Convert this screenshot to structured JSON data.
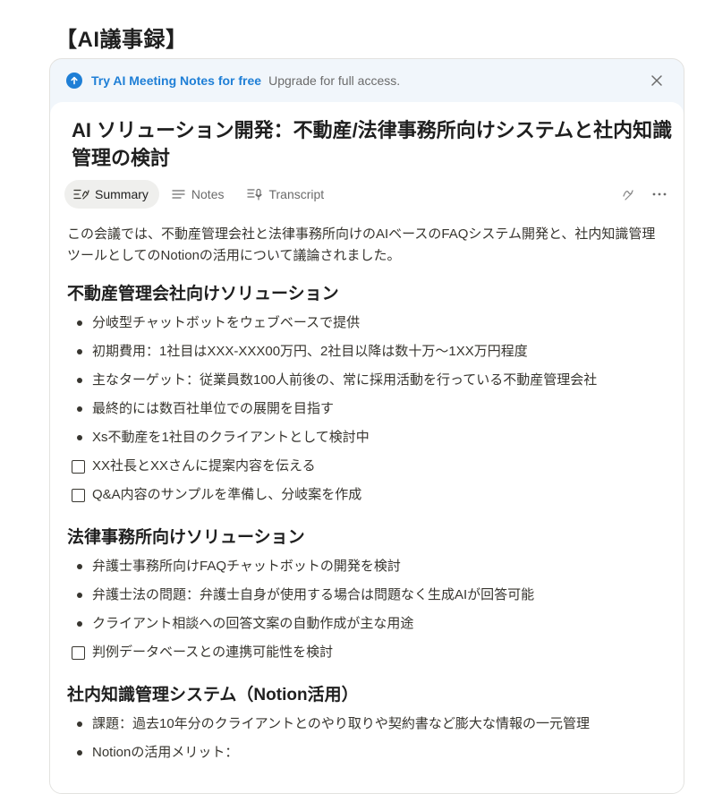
{
  "page_title": "【AI議事録】",
  "banner": {
    "cta": "Try AI Meeting Notes for free",
    "sub": "Upgrade for full access.",
    "icon": "arrow-up-circle-icon",
    "close_icon": "close-icon"
  },
  "meeting": {
    "title": "AI ソリューション開発：不動産/法律事務所向けシステムと社内知識管理の検討"
  },
  "tabs": [
    {
      "label": "Summary",
      "icon": "summary-icon",
      "active": true
    },
    {
      "label": "Notes",
      "icon": "notes-icon",
      "active": false
    },
    {
      "label": "Transcript",
      "icon": "transcript-icon",
      "active": false
    }
  ],
  "intro": "この会議では、不動産管理会社と法律事務所向けのAIベースのFAQシステム開発と、社内知識管理ツールとしてのNotionの活用について議論されました。",
  "sections": [
    {
      "heading": "不動産管理会社向けソリューション",
      "bullets": [
        "分岐型チャットボットをウェブベースで提供",
        "初期費用：1社目はXXX-XXX00万円、2社目以降は数十万〜1XX万円程度",
        "主なターゲット：従業員数100人前後の、常に採用活動を行っている不動産管理会社",
        "最終的には数百社単位での展開を目指す",
        "Xs不動産を1社目のクライアントとして検討中"
      ],
      "todos": [
        "XX社長とXXさんに提案内容を伝える",
        "Q&A内容のサンプルを準備し、分岐案を作成"
      ]
    },
    {
      "heading": "法律事務所向けソリューション",
      "bullets": [
        "弁護士事務所向けFAQチャットボットの開発を検討",
        "弁護士法の問題：弁護士自身が使用する場合は問題なく生成AIが回答可能",
        "クライアント相談への回答文案の自動作成が主な用途"
      ],
      "todos": [
        "判例データベースとの連携可能性を検討"
      ]
    },
    {
      "heading": "社内知識管理システム（Notion活用）",
      "bullets": [
        "課題：過去10年分のクライアントとのやり取りや契約書など膨大な情報の一元管理",
        "Notionの活用メリット："
      ],
      "todos": []
    }
  ],
  "colors": {
    "accent": "#1f7fd6",
    "banner_bg": "#f1f6fb",
    "text": "#37352f"
  }
}
